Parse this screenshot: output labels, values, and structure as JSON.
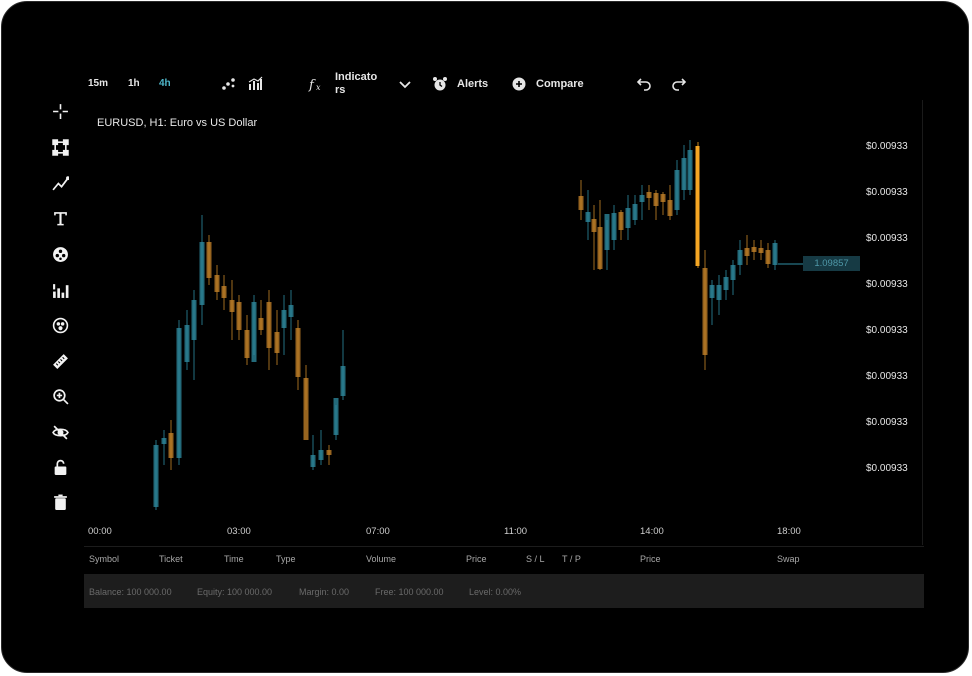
{
  "timeframes": [
    "15m",
    "1h",
    "4h"
  ],
  "active_timeframe": "4h",
  "toolbar": {
    "indicators_label": "Indicators",
    "alerts_label": "Alerts",
    "compare_label": "Compare"
  },
  "sidebar_tools": [
    "crosshair-icon",
    "shape-nodes-icon",
    "trend-line-icon",
    "text-icon",
    "pattern-icon",
    "bars-indicator-icon",
    "emoji-icon",
    "ruler-icon",
    "zoom-in-icon",
    "eye-off-icon",
    "lock-icon",
    "trash-icon"
  ],
  "chart": {
    "title": "EURUSD, H1: Euro vs US Dollar",
    "y_ticks": [
      "$0.00933",
      "$0.00933",
      "$0.00933",
      "$0.00933",
      "$0.00933",
      "$0.00933",
      "$0.00933",
      "$0.00933"
    ],
    "x_ticks": [
      "00:00",
      "03:00",
      "07:00",
      "11:00",
      "14:00",
      "18:00"
    ],
    "current_price": "1.09857"
  },
  "colors": {
    "up": "#2f8ea3",
    "down": "#c9862a",
    "highlight": "#f5a623"
  },
  "table_headers": [
    "Symbol",
    "Ticket",
    "Time",
    "Type",
    "Volume",
    "Price",
    "S / L",
    "T / P",
    "Price",
    "Swap"
  ],
  "footer": {
    "balance": "Balance: 100 000.00",
    "equity": "Equity: 100 000.00",
    "margin": "Margin: 0.00",
    "free": "Free: 100 000.00",
    "level": "Level: 0.00%"
  }
}
